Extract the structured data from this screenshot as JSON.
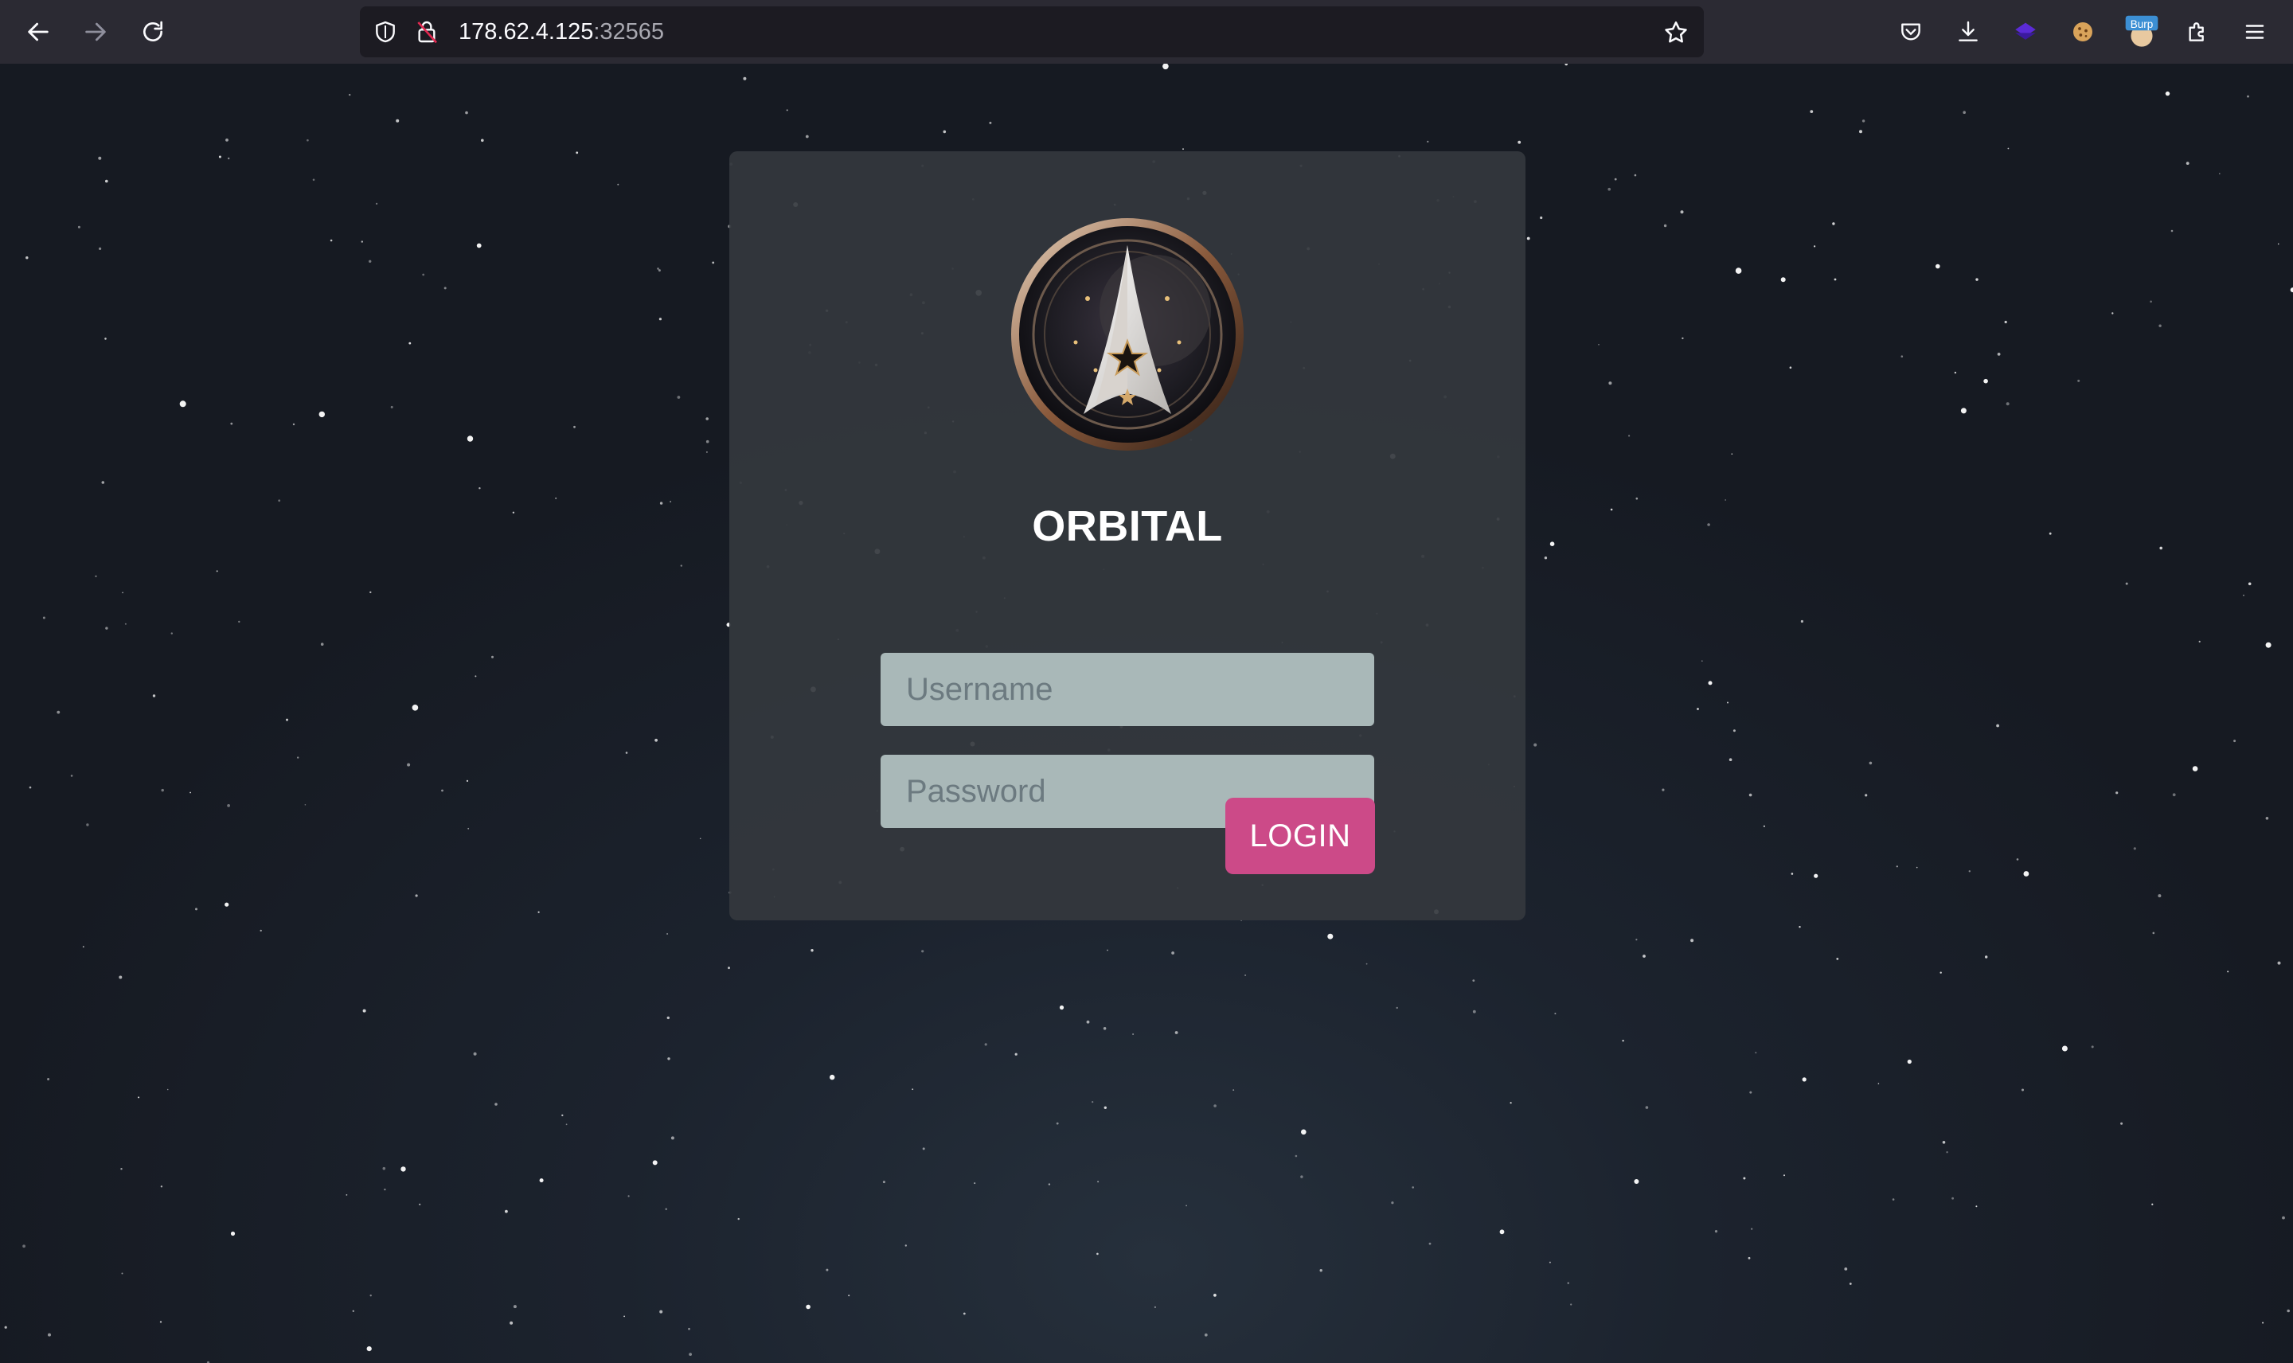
{
  "browser": {
    "url_host": "178.62.4.125",
    "url_port": ":32565",
    "icons": [
      "back-arrow-icon",
      "forward-arrow-icon",
      "reload-icon",
      "shield-icon",
      "insecure-lock-icon",
      "bookmark-star-icon",
      "pocket-icon",
      "download-icon",
      "extension-purple-icon",
      "cookie-icon",
      "burp-extension-icon",
      "extensions-puzzle-icon",
      "menu-hamburger-icon"
    ],
    "burp_badge": "Burp"
  },
  "login": {
    "title": "ORBITAL",
    "username_placeholder": "Username",
    "password_placeholder": "Password",
    "login_label": "LOGIN"
  },
  "colors": {
    "accent": "#cc4a88",
    "card": "#34383d",
    "field": "#a9b8b8",
    "background": "#1a1e27"
  }
}
